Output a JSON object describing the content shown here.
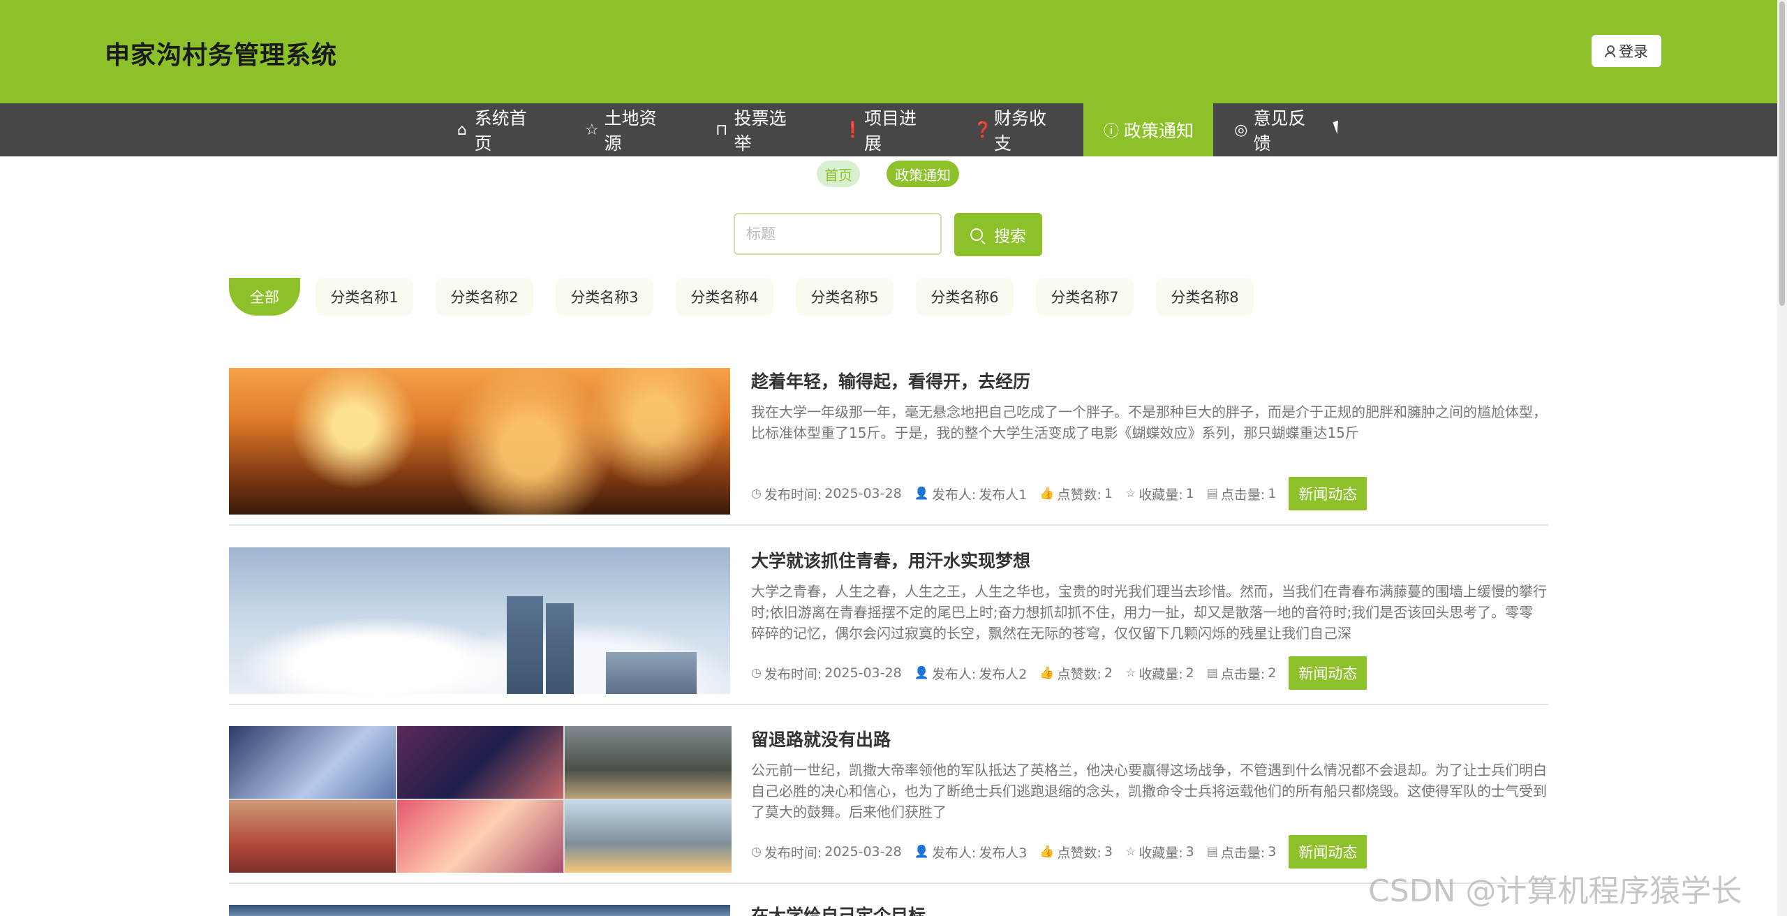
{
  "header": {
    "title": "申家沟村务管理系统",
    "login_label": "登录"
  },
  "nav": {
    "items": [
      {
        "label": "系统首页",
        "icon": "home-icon"
      },
      {
        "label": "土地资源",
        "icon": "star-icon"
      },
      {
        "label": "投票选举",
        "icon": "bag-icon"
      },
      {
        "label": "项目进展",
        "icon": "alert-icon"
      },
      {
        "label": "财务收支",
        "icon": "question-icon"
      },
      {
        "label": "政策通知",
        "icon": "info-icon",
        "active": true
      },
      {
        "label": "意见反馈",
        "icon": "target-icon"
      }
    ]
  },
  "breadcrumb": {
    "home": "首页",
    "current": "政策通知"
  },
  "search": {
    "placeholder": "标题",
    "button_label": "搜索"
  },
  "categories": [
    "全部",
    "分类名称1",
    "分类名称2",
    "分类名称3",
    "分类名称4",
    "分类名称5",
    "分类名称6",
    "分类名称7",
    "分类名称8"
  ],
  "meta_labels": {
    "time": "发布时间:",
    "author": "发布人:",
    "likes": "点赞数:",
    "favorites": "收藏量:",
    "clicks": "点击量:"
  },
  "news": [
    {
      "title": "趁着年轻，输得起，看得开，去经历",
      "summary": "我在大学一年级那一年，毫无悬念地把自己吃成了一个胖子。不是那种巨大的胖子，而是介于正规的肥胖和臃肿之间的尴尬体型，比标准体型重了15斤。于是，我的整个大学生活变成了电影《蝴蝶效应》系列，那只蝴蝶重达15斤",
      "time": "2025-03-28",
      "author": "发布人1",
      "likes": "1",
      "favorites": "1",
      "clicks": "1",
      "tag": "新闻动态"
    },
    {
      "title": "大学就该抓住青春，用汗水实现梦想",
      "summary": "大学之青春，人生之春，人生之王，人生之华也，宝贵的时光我们理当去珍惜。然而，当我们在青春布满藤蔓的围墙上缓慢的攀行时;依旧游离在青春摇摆不定的尾巴上时;奋力想抓却抓不住，用力一扯，却又是散落一地的音符时;我们是否该回头思考了。零零碎碎的记忆，偶尔会闪过寂寞的长空，飘然在无际的苍穹，仅仅留下几颗闪烁的残星让我们自己深",
      "time": "2025-03-28",
      "author": "发布人2",
      "likes": "2",
      "favorites": "2",
      "clicks": "2",
      "tag": "新闻动态"
    },
    {
      "title": "留退路就没有出路",
      "summary": "公元前一世纪，凯撒大帝率领他的军队抵达了英格兰，他决心要赢得这场战争，不管遇到什么情况都不会退却。为了让士兵们明白自己必胜的决心和信心，也为了断绝士兵们逃跑退缩的念头，凯撒命令士兵将运载他们的所有船只都烧毁。这使得军队的士气受到了莫大的鼓舞。后来他们获胜了",
      "time": "2025-03-28",
      "author": "发布人3",
      "likes": "3",
      "favorites": "3",
      "clicks": "3",
      "tag": "新闻动态"
    },
    {
      "title": "在大学给自己定个目标"
    }
  ],
  "watermark": "CSDN @计算机程序猿学长"
}
